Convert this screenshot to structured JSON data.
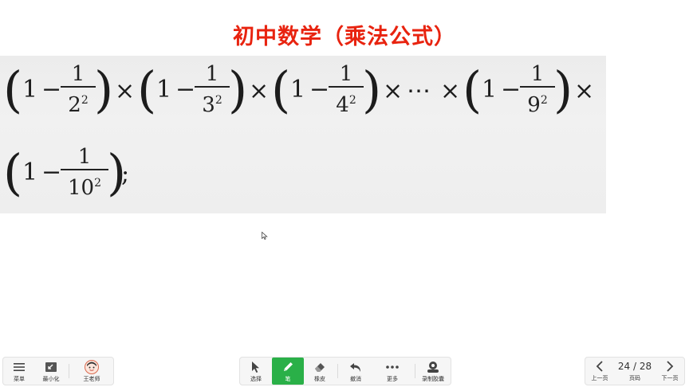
{
  "title": "初中数学（乘法公式）",
  "math": {
    "one": "1",
    "minus": "−",
    "times": "×",
    "dots": "⋯",
    "numerator": "1",
    "semicolon": ";",
    "lparen": "(",
    "rparen": ")",
    "denominators": [
      {
        "base": "2",
        "exp": "2"
      },
      {
        "base": "3",
        "exp": "2"
      },
      {
        "base": "4",
        "exp": "2"
      },
      {
        "base": "9",
        "exp": "2"
      },
      {
        "base": "10",
        "exp": "2"
      }
    ]
  },
  "toolbar_left": {
    "menu_label": "菜单",
    "minimize_label": "最小化",
    "teacher_label": "王老师"
  },
  "toolbar_center": {
    "select_label": "选择",
    "pen_label": "笔",
    "eraser_label": "橡皮",
    "undo_label": "撤消",
    "more_label": "更多",
    "record_label": "录制胶囊"
  },
  "pager": {
    "prev_label": "上一页",
    "page_label": "页码",
    "next_label": "下一页",
    "current": "24 / 28"
  },
  "colors": {
    "title": "#e8230f",
    "active_tool": "#2ab048"
  }
}
